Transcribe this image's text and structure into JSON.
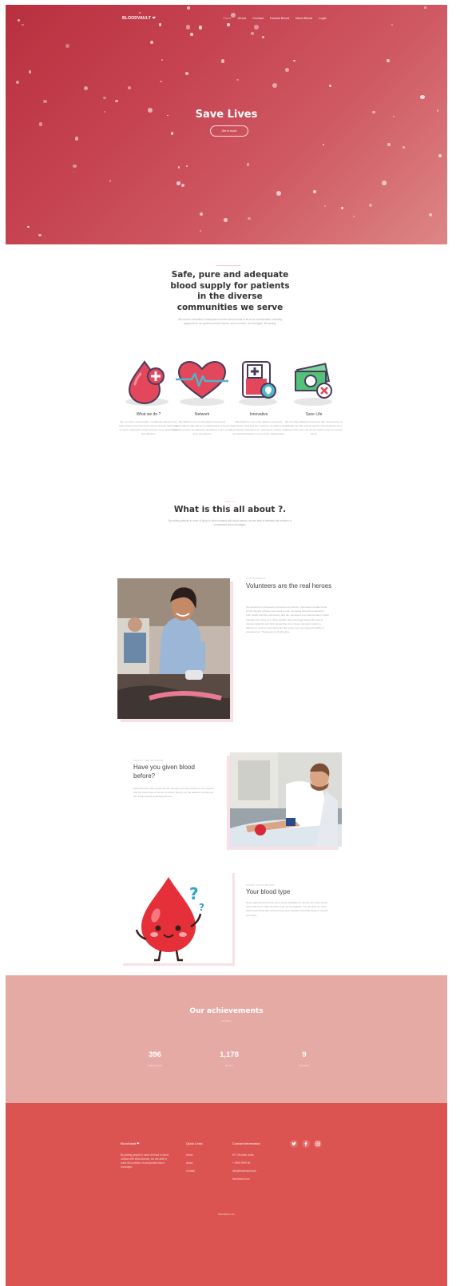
{
  "nav": {
    "logo": "BLOODVAULT ❤",
    "links": [
      "Home",
      "About",
      "Contact",
      "Donate Blood",
      "Need Blood",
      "Login"
    ]
  },
  "hero": {
    "title": "Save Lives",
    "button": "Get in touch"
  },
  "about": {
    "kicker": "WHAT WE DO",
    "title": "Safe, pure and adequate blood supply for patients in the diverse communities we serve",
    "text": "We remain committed to adequate meet the blood needs of all of our communities, including support from our generous blood donors, and of course, our Emergent, life-saving."
  },
  "features": [
    {
      "icon": "blood-drop-plus-icon",
      "title": "What we do ?",
      "desc": "We run easy, unnecessary, conditional machine that helps deliver and rate blood donors directly with those in need, making the whole process more streamlined and effective."
    },
    {
      "icon": "heartbeat-icon",
      "title": "Network",
      "desc": "BloodVault is one of the largest community organizations that acts as a collaborative network, provides prompt and effective assistance in the event of an emergency."
    },
    {
      "icon": "blood-bag-icon",
      "title": "Innovative",
      "desc": "BloodVault is one of the largest community organizations that acts as a network, provides prompt and effective assistance for unforeseen events such as natural disasters or man-made catastrophes."
    },
    {
      "icon": "money-cancel-icon",
      "title": "Save Life",
      "desc": "We are fully unbiased and never ask users to pay for a quality and life-saving search. Our donations go to ensure that users will not be made to pay for a blood donor."
    }
  ],
  "about2": {
    "kicker": "ABOUT",
    "title": "What is this all about ?.",
    "text": "By putting patients in need of blood in direct contact with blood donors, we are able to alleviate the problem of unexpected blood shortages."
  },
  "volunteers": {
    "kicker": "VOLUNTEERS",
    "title": "Volunteers are the real heroes",
    "text": "We depend on volunteers to become our donors. Volunteers donate blood for the benefit of those who need it most. Donating blood is beneficial to both health and the community, and our volunteers are what sustain it. Each donation can help up to three people. We encourage those who can to donate regularly, and help spread the word. Every donation makes a difference, and our volunteers are the reason we can respond quickly in emergencies. Thank you to all who give."
  },
  "given": {
    "kicker": "ABOUT THE DONORS",
    "title": "Have you given blood before?",
    "text": "Appointments with regular donors are given priority, based on our records, and the blood type of donors is shown directly on the platform so that you can easily identify matching donors."
  },
  "bloodtype": {
    "kicker": "KNOW YOUR BLOOD",
    "title": "Your blood type",
    "text": "Some appointments have been made available for donors who have blood types that are in high demand, such as O-negative. You can find out more about your blood type and see how your donation can help those in need in your area."
  },
  "achievements": {
    "title": "Our achievements",
    "subtitle": "Numbers",
    "stats": [
      {
        "value": "396",
        "label": "Helped Users"
      },
      {
        "value": "1,178",
        "label": "Donors"
      },
      {
        "value": "9",
        "label": "Hospitals"
      }
    ]
  },
  "footer": {
    "brand": "BloodVault ❤",
    "brand_text": "By putting people in need of blood in direct contact with blood donors, we are able to solve the problem of unexpected blood shortages.",
    "quick_title": "Quick Links",
    "quick_links": [
      "Home",
      "About",
      "Contact"
    ],
    "contact_title": "Contact Information",
    "contact": [
      "HIT, Mumbai, India",
      "+ 9999 9999 99",
      "info@bloodvault.com",
      "bloodvault.com"
    ],
    "social": [
      "twitter-icon",
      "facebook-icon",
      "instagram-icon"
    ],
    "copyright": "BloodVault.com"
  },
  "colors": {
    "brand_red": "#dc5452",
    "achieve_bg": "#e6aaa5",
    "hero_dark": "#b8303f",
    "hero_light": "#dd8686"
  }
}
